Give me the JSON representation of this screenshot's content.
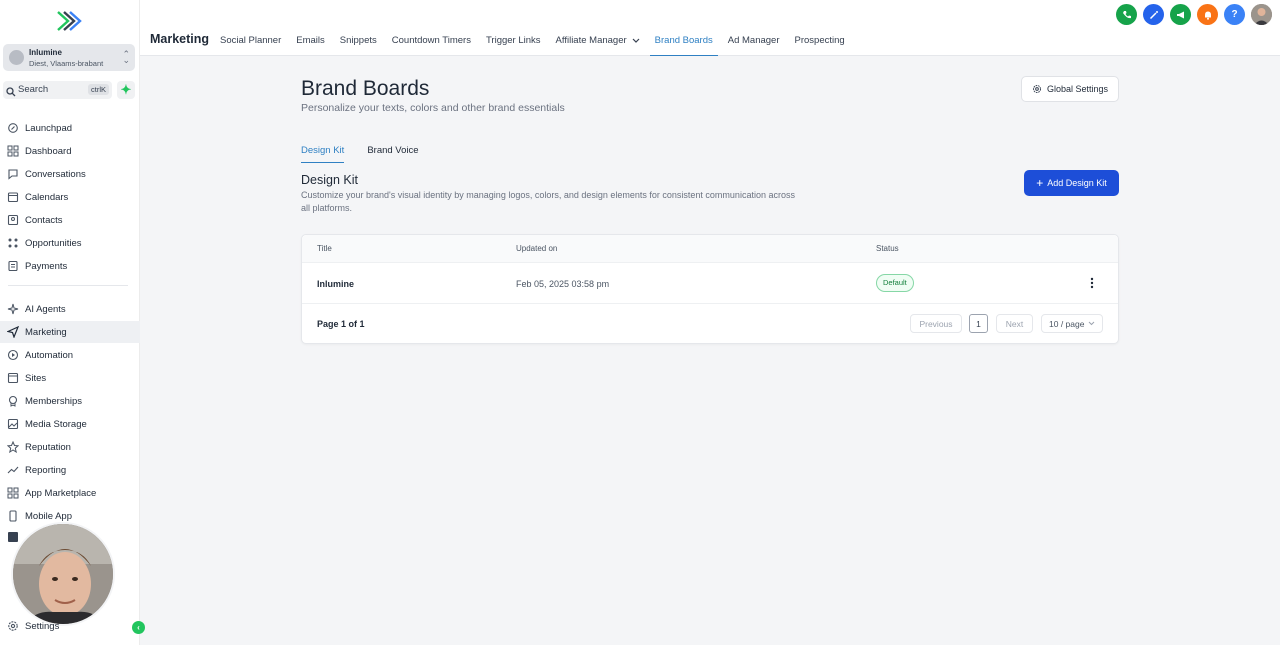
{
  "sidebar": {
    "account": {
      "name": "Inlumine",
      "location": "Diest, Vlaams-brabant"
    },
    "search": {
      "label": "Search",
      "shortcut": "ctrlK"
    },
    "items": [
      {
        "label": "Launchpad",
        "icon": "rocket-icon"
      },
      {
        "label": "Dashboard",
        "icon": "dashboard-icon"
      },
      {
        "label": "Conversations",
        "icon": "chat-icon"
      },
      {
        "label": "Calendars",
        "icon": "calendar-icon"
      },
      {
        "label": "Contacts",
        "icon": "contacts-icon"
      },
      {
        "label": "Opportunities",
        "icon": "opportunities-icon"
      },
      {
        "label": "Payments",
        "icon": "payments-icon"
      },
      {
        "label": "AI Agents",
        "icon": "sparkle-icon"
      },
      {
        "label": "Marketing",
        "icon": "send-icon"
      },
      {
        "label": "Automation",
        "icon": "automation-icon"
      },
      {
        "label": "Sites",
        "icon": "sites-icon"
      },
      {
        "label": "Memberships",
        "icon": "memberships-icon"
      },
      {
        "label": "Media Storage",
        "icon": "image-icon"
      },
      {
        "label": "Reputation",
        "icon": "star-icon"
      },
      {
        "label": "Reporting",
        "icon": "trend-icon"
      },
      {
        "label": "App Marketplace",
        "icon": "grid-icon"
      },
      {
        "label": "Mobile App",
        "icon": "phone-device-icon"
      }
    ],
    "settings_label": "Settings"
  },
  "header": {
    "title": "Marketing",
    "tabs": [
      {
        "label": "Social Planner"
      },
      {
        "label": "Emails"
      },
      {
        "label": "Snippets"
      },
      {
        "label": "Countdown Timers"
      },
      {
        "label": "Trigger Links"
      },
      {
        "label": "Affiliate Manager"
      },
      {
        "label": "Brand Boards"
      },
      {
        "label": "Ad Manager"
      },
      {
        "label": "Prospecting"
      }
    ],
    "active_tab": "Brand Boards",
    "quick_actions": [
      {
        "icon": "phone-icon",
        "color": "#16a34a"
      },
      {
        "icon": "magic-icon",
        "color": "#2563eb"
      },
      {
        "icon": "megaphone-icon",
        "color": "#16a34a"
      },
      {
        "icon": "bell-icon",
        "color": "#f97316"
      },
      {
        "icon": "help-icon",
        "color": "#3b82f6",
        "glyph": "?"
      }
    ]
  },
  "page": {
    "title": "Brand Boards",
    "subtitle": "Personalize your texts, colors and other brand essentials",
    "global_settings_label": "Global Settings",
    "subtabs": [
      {
        "label": "Design Kit"
      },
      {
        "label": "Brand Voice"
      }
    ],
    "active_subtab": "Design Kit",
    "section_title": "Design Kit",
    "section_desc": "Customize your brand's visual identity by managing logos, colors, and design elements for consistent communication across all platforms.",
    "add_button_label": "Add Design Kit"
  },
  "table": {
    "columns": {
      "title": "Title",
      "updated": "Updated on",
      "status": "Status"
    },
    "rows": [
      {
        "title": "Inlumine",
        "updated": "Feb 05, 2025 03:58 pm",
        "status": "Default"
      }
    ],
    "pagination": {
      "info": "Page 1 of 1",
      "previous": "Previous",
      "page": "1",
      "next": "Next",
      "page_size": "10 / page"
    }
  },
  "colors": {
    "accent": "#2f80c3",
    "primary_button": "#1d4ed8",
    "status_green": "#15803d"
  }
}
